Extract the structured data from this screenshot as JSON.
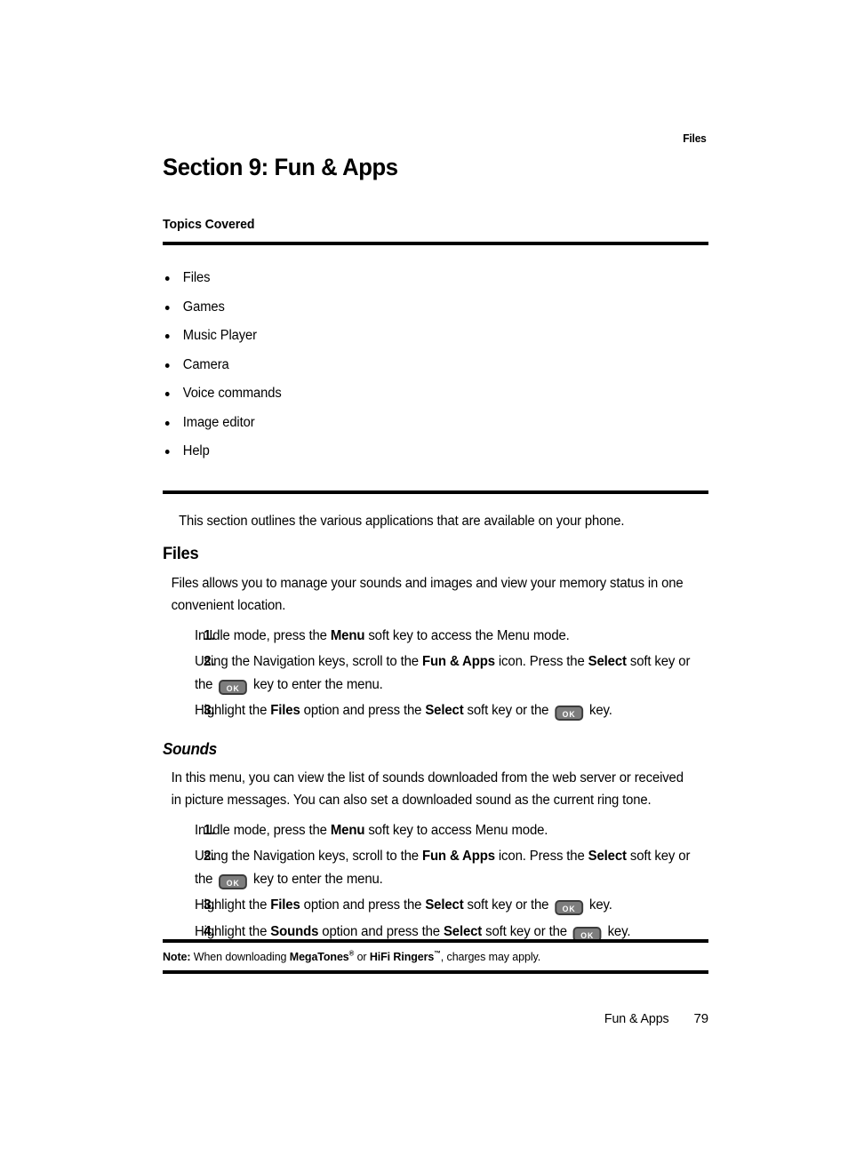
{
  "running_head": "Files",
  "section_title": "Section 9: Fun & Apps",
  "topics_label": "Topics Covered",
  "topics": [
    "Files",
    "Games",
    "Music Player",
    "Camera",
    "Voice commands",
    "Image editor",
    "Help"
  ],
  "intro_paragraph": "This section outlines the various applications that are available on your phone.",
  "files_section": {
    "heading": "Files",
    "paragraph": "Files allows you to manage your sounds and images and view your memory status in one convenient location.",
    "steps": [
      {
        "number": "1.",
        "parts": [
          {
            "t": "In Idle mode, press the ",
            "b": false
          },
          {
            "t": "Menu",
            "b": true
          },
          {
            "t": " soft key to access the Menu mode.",
            "b": false
          }
        ]
      },
      {
        "number": "2.",
        "parts": [
          {
            "t": "Using the Navigation keys, scroll to the ",
            "b": false
          },
          {
            "t": "Fun & Apps",
            "b": true
          },
          {
            "t": " icon. Press the ",
            "b": false
          },
          {
            "t": "Select",
            "b": true
          },
          {
            "t": " soft key or the ",
            "b": false
          },
          {
            "t": "OK",
            "key": true
          },
          {
            "t": " key to enter the menu.",
            "b": false
          }
        ]
      },
      {
        "number": "3.",
        "parts": [
          {
            "t": "Highlight the ",
            "b": false
          },
          {
            "t": "Files",
            "b": true
          },
          {
            "t": " option and press the ",
            "b": false
          },
          {
            "t": "Select",
            "b": true
          },
          {
            "t": " soft key or the ",
            "b": false
          },
          {
            "t": "OK",
            "key": true
          },
          {
            "t": " key.",
            "b": false
          }
        ]
      }
    ]
  },
  "sounds_section": {
    "heading": "Sounds",
    "paragraph": "In this menu, you can view the list of sounds downloaded from the web server or received in picture messages. You can also set a downloaded sound as the current ring tone.",
    "steps": [
      {
        "number": "1.",
        "parts": [
          {
            "t": "In Idle mode, press the ",
            "b": false
          },
          {
            "t": "Menu",
            "b": true
          },
          {
            "t": " soft key to access Menu mode.",
            "b": false
          }
        ]
      },
      {
        "number": "2.",
        "parts": [
          {
            "t": "Using the Navigation keys, scroll to the ",
            "b": false
          },
          {
            "t": "Fun & Apps",
            "b": true
          },
          {
            "t": " icon. Press the ",
            "b": false
          },
          {
            "t": "Select",
            "b": true
          },
          {
            "t": " soft key or the ",
            "b": false
          },
          {
            "t": "OK",
            "key": true
          },
          {
            "t": " key to enter the menu.",
            "b": false
          }
        ]
      },
      {
        "number": "3.",
        "parts": [
          {
            "t": "Highlight the ",
            "b": false
          },
          {
            "t": "Files",
            "b": true
          },
          {
            "t": " option and press the ",
            "b": false
          },
          {
            "t": "Select",
            "b": true
          },
          {
            "t": " soft key or the ",
            "b": false
          },
          {
            "t": "OK",
            "key": true
          },
          {
            "t": " key.",
            "b": false
          }
        ]
      },
      {
        "number": "4.",
        "parts": [
          {
            "t": "Highlight the ",
            "b": false
          },
          {
            "t": "Sounds",
            "b": true
          },
          {
            "t": " option and press the ",
            "b": false
          },
          {
            "t": "Select",
            "b": true
          },
          {
            "t": " soft key or the ",
            "b": false
          },
          {
            "t": "OK",
            "key": true
          },
          {
            "t": " key.",
            "b": false
          }
        ]
      }
    ]
  },
  "note": {
    "parts": [
      {
        "t": "Note:",
        "b": true
      },
      {
        "t": " When downloading ",
        "b": false
      },
      {
        "t": "MegaTones",
        "b": true
      },
      {
        "t": "®",
        "b": true,
        "sup": true
      },
      {
        "t": " or ",
        "b": false
      },
      {
        "t": "HiFi Ringers",
        "b": true
      },
      {
        "t": "™",
        "b": true,
        "sup": true
      },
      {
        "t": ", charges may apply.",
        "b": false
      }
    ]
  },
  "footer": {
    "chapter": "Fun & Apps",
    "page_number": "79"
  },
  "key_glyph_label": "OK",
  "colors": {
    "text": "#000000",
    "page_background": "#ffffff",
    "key_fill": "#7d7d7d",
    "key_border": "#3b3b3b",
    "key_label": "#ffffff",
    "rule": "#000000"
  }
}
